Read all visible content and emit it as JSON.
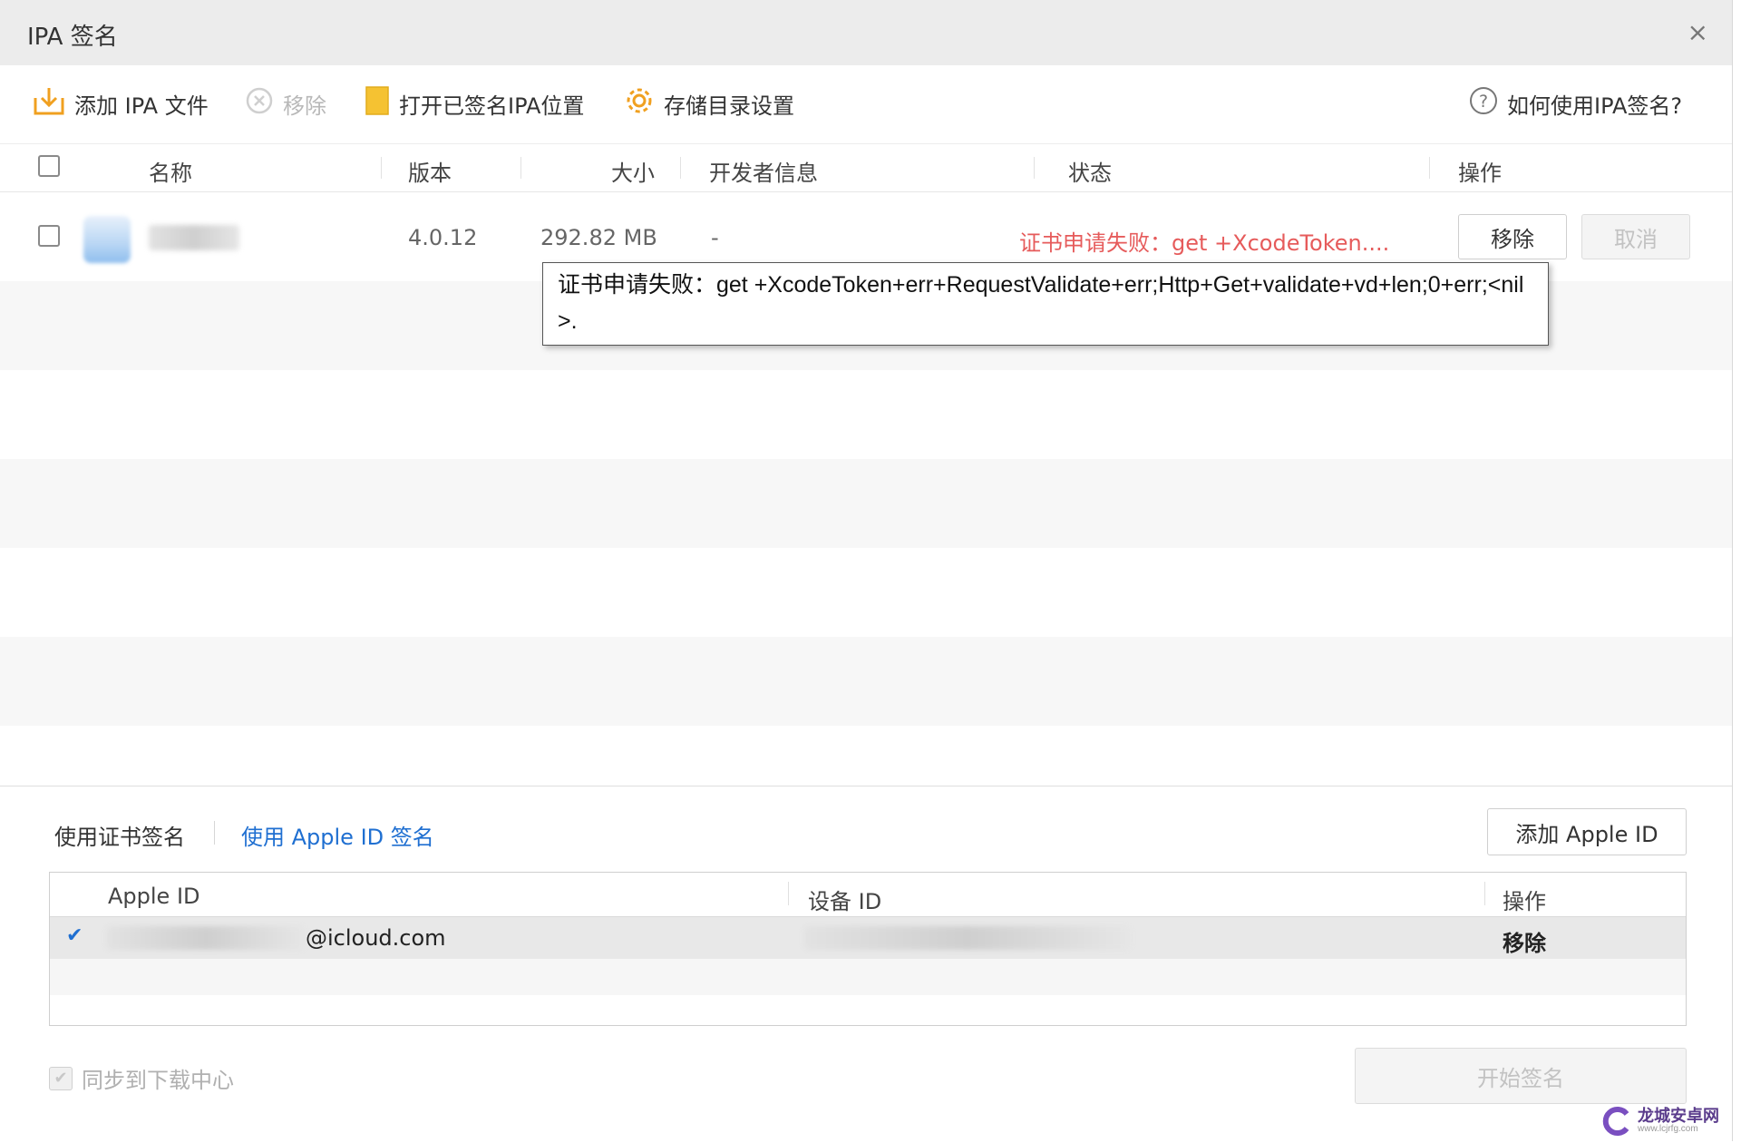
{
  "window": {
    "title": "IPA 签名",
    "close_glyph": "×"
  },
  "toolbar": {
    "add_ipa": "添加 IPA 文件",
    "remove": "移除",
    "open_signed_location": "打开已签名IPA位置",
    "storage_settings": "存储目录设置",
    "help": "如何使用IPA签名?"
  },
  "table": {
    "headers": {
      "name": "名称",
      "version": "版本",
      "size": "大小",
      "developer": "开发者信息",
      "status": "状态",
      "action": "操作"
    },
    "rows": [
      {
        "name": "",
        "version": "4.0.12",
        "size": "292.82 MB",
        "developer": "-",
        "status": "证书申请失败：get +XcodeToken....",
        "remove_btn": "移除",
        "cancel_btn": "取消"
      }
    ]
  },
  "tooltip": {
    "text": "证书申请失败：get +XcodeToken+err+RequestValidate+err;Http+Get+validate+vd+len;0+err;<nil>."
  },
  "bottom": {
    "tab_cert": "使用证书签名",
    "tab_appleid": "使用 Apple ID 签名",
    "add_apple_id": "添加 Apple ID",
    "grid_headers": {
      "apple_id": "Apple ID",
      "device_id": "设备 ID",
      "action": "操作"
    },
    "accounts": [
      {
        "apple_id_suffix": "@icloud.com",
        "device_id": "",
        "action": "移除",
        "selected": true
      }
    ],
    "sync_label": "同步到下载中心",
    "start_sign": "开始签名"
  },
  "watermark": {
    "title": "龙城安卓网",
    "url": "www.lcjrfg.com"
  },
  "colors": {
    "accent_blue": "#1f6fd1",
    "error_red": "#e65b5b",
    "folder_yellow": "#f5c232",
    "gear_orange": "#f0a020"
  },
  "icons": {
    "add_ipa": "download-tray-icon",
    "remove": "circle-x-icon",
    "open_location": "folder-icon",
    "storage_settings": "gear-icon",
    "help": "question-circle-icon"
  }
}
